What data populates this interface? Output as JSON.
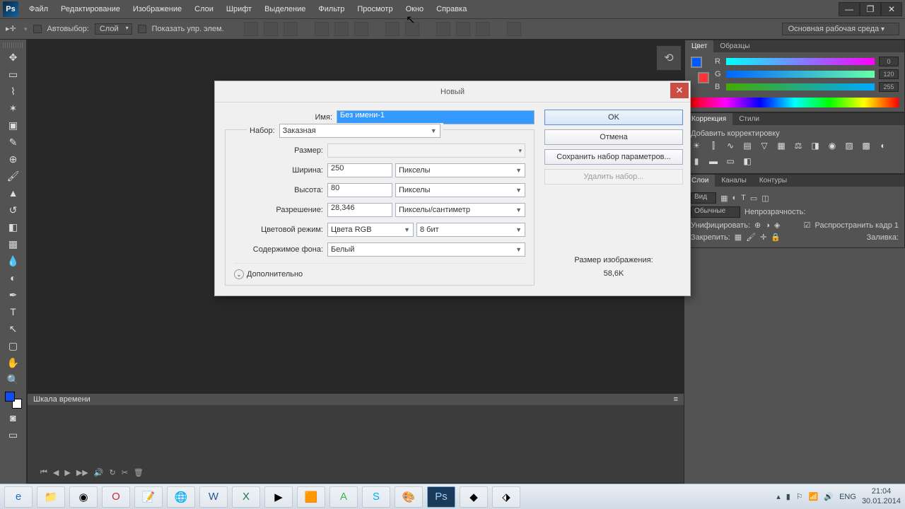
{
  "menu": {
    "items": [
      "Файл",
      "Редактирование",
      "Изображение",
      "Слои",
      "Шрифт",
      "Выделение",
      "Фильтр",
      "Просмотр",
      "Окно",
      "Справка"
    ]
  },
  "options": {
    "autoselect": "Автовыбор:",
    "layer": "Слой",
    "show_controls": "Показать упр. элем.",
    "workspace": "Основная рабочая среда"
  },
  "panels": {
    "color": {
      "tabs": [
        "Цвет",
        "Образцы"
      ],
      "r": "R",
      "g": "G",
      "b": "B",
      "rv": "0",
      "gv": "120",
      "bv": "255"
    },
    "adjust": {
      "tabs": [
        "Коррекция",
        "Стили"
      ],
      "add": "Добавить корректировку"
    },
    "layers": {
      "tabs": [
        "Слои",
        "Каналы",
        "Контуры"
      ],
      "kind": "Вид",
      "blend": "Обычные",
      "opacity": "Непрозрачность:",
      "unify": "Унифицировать:",
      "propagate": "Распространить кадр 1",
      "lock": "Закрепить:",
      "fill": "Заливка:"
    }
  },
  "timeline": {
    "title": "Шкала времени"
  },
  "dialog": {
    "title": "Новый",
    "labels": {
      "name": "Имя:",
      "preset": "Набор:",
      "size": "Размер:",
      "width": "Ширина:",
      "height": "Высота:",
      "resolution": "Разрешение:",
      "colormode": "Цветовой режим:",
      "bg": "Содержимое фона:",
      "advanced": "Дополнительно"
    },
    "values": {
      "name": "Без имени-1",
      "preset": "Заказная",
      "size": "",
      "width": "250",
      "height": "80",
      "resolution": "28,346",
      "px": "Пикселы",
      "pxcm": "Пикселы/сантиметр",
      "colormode": "Цвета RGB",
      "bits": "8 бит",
      "bg": "Белый"
    },
    "buttons": {
      "ok": "OK",
      "cancel": "Отмена",
      "save": "Сохранить набор параметров...",
      "delete": "Удалить набор..."
    },
    "img_size_label": "Размер изображения:",
    "img_size_val": "58,6K"
  },
  "tray": {
    "lang": "ENG",
    "time": "21:04",
    "date": "30.01.2014"
  },
  "colors": {
    "accent": "#3399ff"
  }
}
